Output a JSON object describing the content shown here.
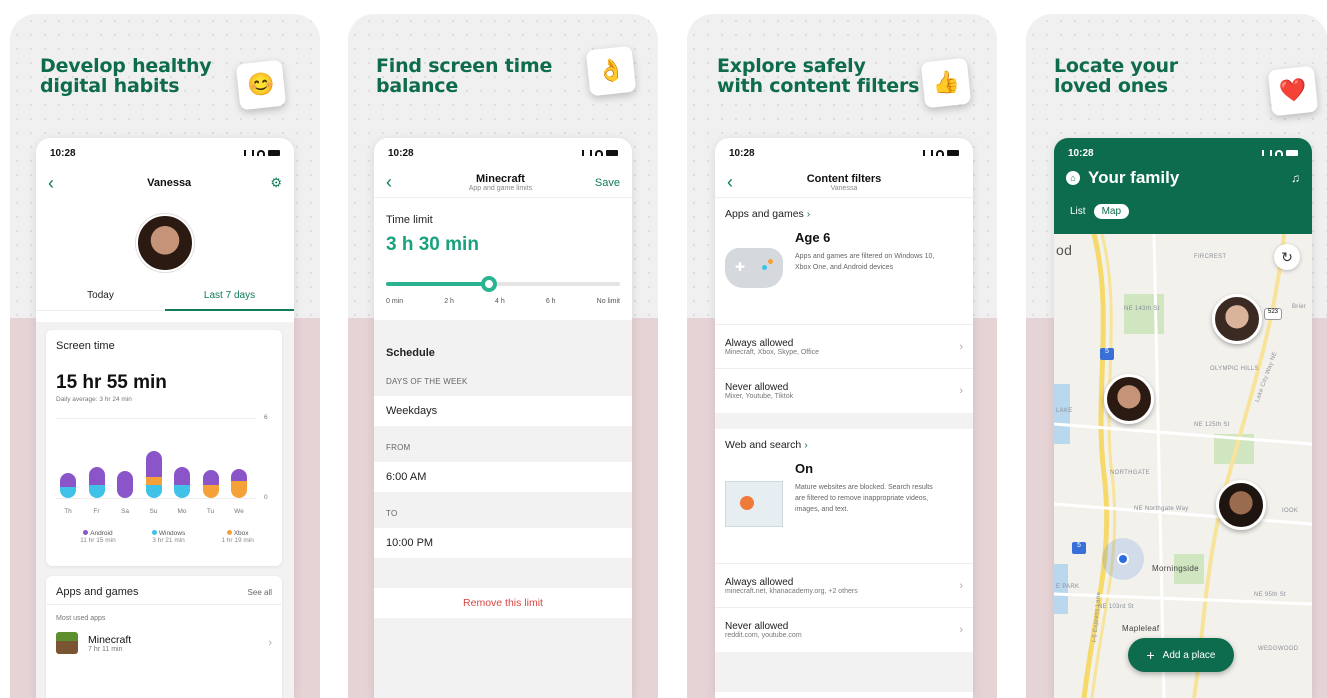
{
  "panels": [
    {
      "headline": "Develop healthy\ndigital habits",
      "sticker": "😊"
    },
    {
      "headline": "Find screen time\nbalance",
      "sticker": "👌"
    },
    {
      "headline": "Explore safely\nwith content filters",
      "sticker": "👍"
    },
    {
      "headline": "Locate your\nloved ones",
      "sticker": "❤️"
    }
  ],
  "status_time": [
    "10:28",
    "10:28",
    "10:28",
    "10:28"
  ],
  "screen1": {
    "title": "Vanessa",
    "tab_today": "Today",
    "tab_week": "Last 7 days",
    "screen_time_label": "Screen time",
    "total": "15 hr 55 min",
    "daily_avg": "Daily average: 3 hr 24 min",
    "axis_top": "6",
    "axis_bottom": "0",
    "legend": [
      {
        "name": "Android",
        "value": "11 hr 15 min",
        "color": "#8a55c9"
      },
      {
        "name": "Windows",
        "value": "3 hr 21 min",
        "color": "#3fc1e8"
      },
      {
        "name": "Xbox",
        "value": "1 hr 19 min",
        "color": "#f5a13a"
      }
    ],
    "apps_label": "Apps and games",
    "see_all": "See all",
    "most_used": "Most used apps",
    "app_name": "Minecraft",
    "app_time": "7 hr 11 min"
  },
  "chart_data": {
    "type": "bar",
    "categories": [
      "Th",
      "Fr",
      "Sa",
      "Su",
      "Mo",
      "Tu",
      "We"
    ],
    "series": [
      {
        "name": "Windows",
        "values": [
          0.8,
          1.0,
          0,
          1.0,
          1.0,
          0,
          0
        ]
      },
      {
        "name": "Xbox",
        "values": [
          0,
          0,
          0,
          0.6,
          0,
          1.0,
          1.3
        ]
      },
      {
        "name": "Android",
        "values": [
          1.1,
          1.3,
          2.0,
          1.9,
          1.3,
          1.1,
          0.9
        ]
      }
    ],
    "ylim": [
      0,
      6
    ],
    "colors": {
      "Android": "#8a55c9",
      "Windows": "#3fc1e8",
      "Xbox": "#f5a13a"
    }
  },
  "screen2": {
    "title": "Minecraft",
    "subtitle": "App and game limits",
    "save": "Save",
    "time_limit_label": "Time limit",
    "time_limit_value": "3 h 30 min",
    "slider_ticks": [
      "0 min",
      "2 h",
      "4 h",
      "6 h",
      "No limit"
    ],
    "slider_level": 0.44,
    "schedule": "Schedule",
    "days_caption": "DAYS OF THE WEEK",
    "days_value": "Weekdays",
    "from_caption": "FROM",
    "from_value": "6:00 AM",
    "to_caption": "TO",
    "to_value": "10:00 PM",
    "remove": "Remove this limit"
  },
  "screen3": {
    "title": "Content filters",
    "subtitle": "Vanessa",
    "apps_header": "Apps and games",
    "age": "Age 6",
    "age_desc": "Apps and games are filtered on Windows 10, Xbox One, and Android devices",
    "always_allowed_1": "Always allowed",
    "always_allowed_1_sub": "Minecraft, Xbox, Skype, Office",
    "never_allowed_1": "Never allowed",
    "never_allowed_1_sub": "Mixer, Youtube, Tiktok",
    "web_header": "Web and search",
    "web_state": "On",
    "web_desc": "Mature websites are blocked. Search results are filtered to remove inappropriate videos, images, and text.",
    "always_allowed_2": "Always allowed",
    "always_allowed_2_sub": "minecraft.net, khanacademy.org, +2 others",
    "never_allowed_2": "Never allowed",
    "never_allowed_2_sub": "reddit.com, youtube.com"
  },
  "screen4": {
    "title": "Your family",
    "tab_list": "List",
    "tab_map": "Map",
    "add_place": "Add a place",
    "map_labels": [
      "od",
      "FIRCREST",
      "NE 143th St",
      "Brier",
      "OLYMPIC HILLS",
      "LAKE",
      "NE 125th St",
      "NORTHGATE",
      "NE Northgate Way",
      "IOOK",
      "Morningside",
      "E PARK",
      "NE 95th St",
      "NE 103rd St",
      "Mapleleaf",
      "WEDGWOOD",
      "I-5 Express Lane",
      "Lake City Way NE"
    ],
    "shields": [
      "5",
      "523",
      "5"
    ]
  }
}
